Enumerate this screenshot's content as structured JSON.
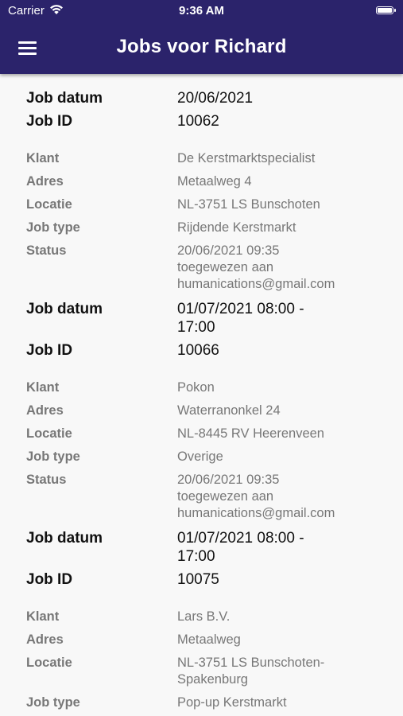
{
  "status_bar": {
    "carrier": "Carrier",
    "time": "9:36 AM"
  },
  "header": {
    "title": "Jobs voor Richard",
    "menu_icon": "hamburger-menu-icon",
    "background_color": "#2b236b"
  },
  "labels": {
    "job_datum": "Job datum",
    "job_id": "Job ID",
    "klant": "Klant",
    "adres": "Adres",
    "locatie": "Locatie",
    "job_type": "Job type",
    "status": "Status"
  },
  "jobs": [
    {
      "job_datum": "20/06/2021",
      "job_id": "10062",
      "klant": "De Kerstmarktspecialist",
      "adres": "Metaalweg 4",
      "locatie": "NL-3751 LS Bunschoten",
      "job_type": "Rijdende Kerstmarkt",
      "status": "20/06/2021 09:35\ntoegewezen aan\nhumanications@gmail.com"
    },
    {
      "job_datum": "01/07/2021 08:00 -\n17:00",
      "job_id": "10066",
      "klant": "Pokon",
      "adres": "Waterranonkel 24",
      "locatie": "NL-8445 RV Heerenveen",
      "job_type": "Overige",
      "status": "20/06/2021 09:35\ntoegewezen aan\nhumanications@gmail.com"
    },
    {
      "job_datum": "01/07/2021 08:00 -\n17:00",
      "job_id": "10075",
      "klant": "Lars B.V.",
      "adres": "Metaalweg",
      "locatie": "NL-3751 LS Bunschoten-\nSpakenburg",
      "job_type": "Pop-up Kerstmarkt",
      "status": ""
    }
  ]
}
